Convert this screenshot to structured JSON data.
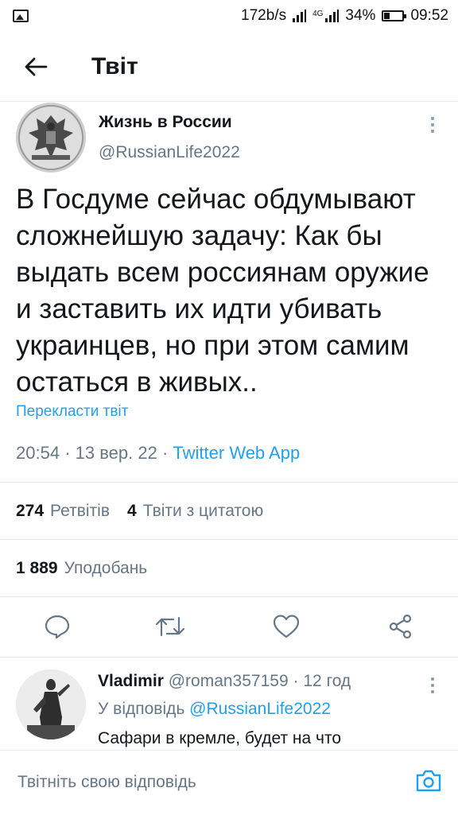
{
  "status_bar": {
    "speed": "172b/s",
    "network": "4G",
    "battery": "34%",
    "time": "09:52"
  },
  "header": {
    "title": "Твіт"
  },
  "tweet": {
    "author_name": "Жизнь в России",
    "author_handle": "@RussianLife2022",
    "text": "В Госдуме сейчас обдумывают сложнейшую задачу: Как бы выдать всем россиянам оружие и заставить их идти убивать украинцев, но при этом самим остаться в живых..",
    "translate_label": "Перекласти твіт",
    "time": "20:54",
    "date": "13 вер. 22",
    "source": "Twitter Web App",
    "retweets_count": "274",
    "retweets_label": "Ретвітів",
    "quotes_count": "4",
    "quotes_label": "Твіти з цитатою",
    "likes_count": "1 889",
    "likes_label": "Уподобань"
  },
  "actions": {
    "icons": [
      "reply-icon",
      "retweet-icon",
      "like-icon",
      "share-icon"
    ],
    "color": "#657786"
  },
  "reply": {
    "author_name": "Vladimir",
    "author_handle": "@roman357159",
    "age": "12 год",
    "reply_to_prefix": "У відповідь",
    "reply_to_handle": "@RussianLife2022",
    "text": "Сафари в кремле, будет на что"
  },
  "composer": {
    "placeholder": "Твітніть свою відповідь"
  },
  "colors": {
    "accent": "#1da1f2",
    "secondary_text": "#657786",
    "primary_text": "#14171a",
    "divider": "#e6ecf0"
  }
}
